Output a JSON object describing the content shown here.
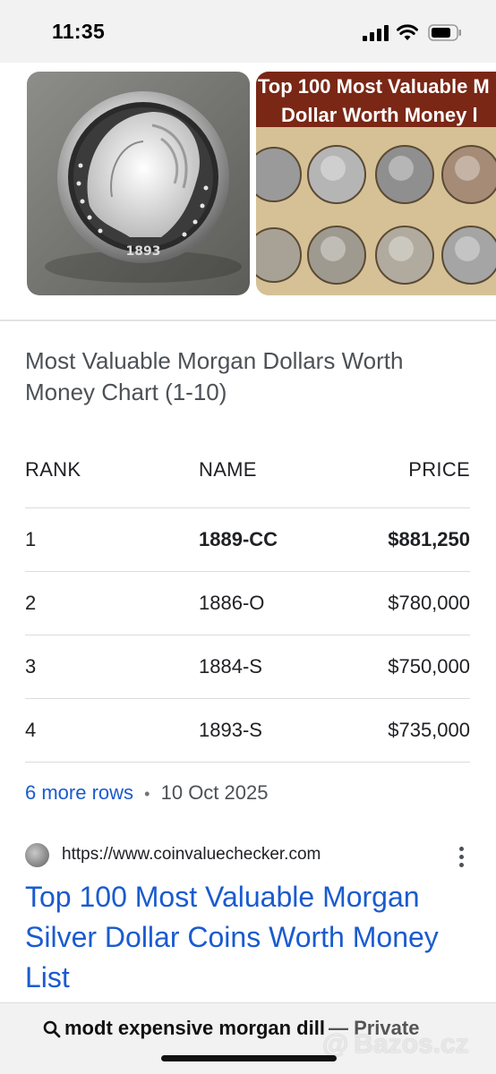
{
  "status_bar": {
    "time": "11:35"
  },
  "images": {
    "coin_year": "1893",
    "banner_line1": "Top 100 Most Valuable M",
    "banner_line2": "Dollar Worth Money l"
  },
  "chart": {
    "title": "Most Valuable Morgan Dollars Worth Money Chart (1-10)",
    "headers": [
      "RANK",
      "NAME",
      "PRICE"
    ],
    "rows": [
      {
        "rank": "1",
        "name": "1889-CC",
        "price": "$881,250"
      },
      {
        "rank": "2",
        "name": "1886-O",
        "price": "$780,000"
      },
      {
        "rank": "3",
        "name": "1884-S",
        "price": "$750,000"
      },
      {
        "rank": "4",
        "name": "1893-S",
        "price": "$735,000"
      }
    ],
    "more_rows": "6 more rows",
    "separator": "•",
    "date": "10 Oct 2025"
  },
  "result": {
    "url": "https://www.coinvaluechecker.com",
    "title": "Top 100 Most Valuable Morgan Silver Dollar Coins Worth Money List"
  },
  "bottom_bar": {
    "query": "modt expensive morgan dill",
    "private_label": "— Private",
    "watermark": "Bazos.cz"
  }
}
